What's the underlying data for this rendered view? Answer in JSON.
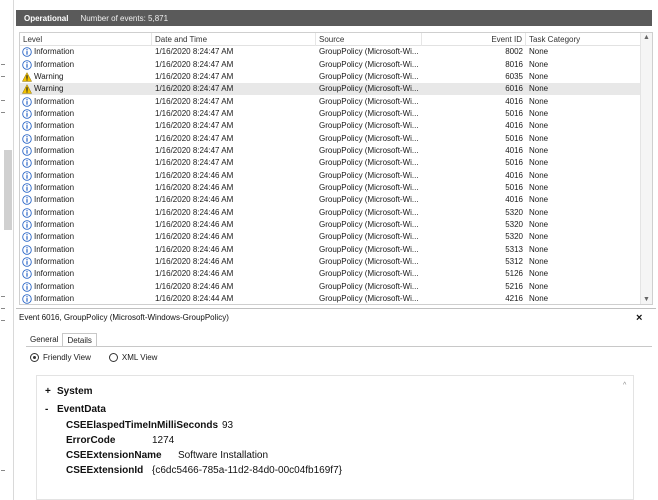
{
  "header": {
    "title": "Operational",
    "event_count": "Number of events: 5,871"
  },
  "columns": {
    "level": "Level",
    "date": "Date and Time",
    "source": "Source",
    "event_id": "Event ID",
    "task_category": "Task Category"
  },
  "icons": {
    "information": "info-icon",
    "warning": "warning-icon"
  },
  "colors": {
    "info": "#2a66c7",
    "warning": "#f2c200",
    "header_bg": "#5a5a5a",
    "selected_row": "#e8e8e8"
  },
  "events": [
    {
      "level": "Information",
      "date": "1/16/2020 8:24:47 AM",
      "source": "GroupPolicy (Microsoft-Wi...",
      "id": "8002",
      "category": "None"
    },
    {
      "level": "Information",
      "date": "1/16/2020 8:24:47 AM",
      "source": "GroupPolicy (Microsoft-Wi...",
      "id": "8016",
      "category": "None"
    },
    {
      "level": "Warning",
      "date": "1/16/2020 8:24:47 AM",
      "source": "GroupPolicy (Microsoft-Wi...",
      "id": "6035",
      "category": "None"
    },
    {
      "level": "Warning",
      "date": "1/16/2020 8:24:47 AM",
      "source": "GroupPolicy (Microsoft-Wi...",
      "id": "6016",
      "category": "None",
      "selected": true
    },
    {
      "level": "Information",
      "date": "1/16/2020 8:24:47 AM",
      "source": "GroupPolicy (Microsoft-Wi...",
      "id": "4016",
      "category": "None"
    },
    {
      "level": "Information",
      "date": "1/16/2020 8:24:47 AM",
      "source": "GroupPolicy (Microsoft-Wi...",
      "id": "5016",
      "category": "None"
    },
    {
      "level": "Information",
      "date": "1/16/2020 8:24:47 AM",
      "source": "GroupPolicy (Microsoft-Wi...",
      "id": "4016",
      "category": "None"
    },
    {
      "level": "Information",
      "date": "1/16/2020 8:24:47 AM",
      "source": "GroupPolicy (Microsoft-Wi...",
      "id": "5016",
      "category": "None"
    },
    {
      "level": "Information",
      "date": "1/16/2020 8:24:47 AM",
      "source": "GroupPolicy (Microsoft-Wi...",
      "id": "4016",
      "category": "None"
    },
    {
      "level": "Information",
      "date": "1/16/2020 8:24:47 AM",
      "source": "GroupPolicy (Microsoft-Wi...",
      "id": "5016",
      "category": "None"
    },
    {
      "level": "Information",
      "date": "1/16/2020 8:24:46 AM",
      "source": "GroupPolicy (Microsoft-Wi...",
      "id": "4016",
      "category": "None"
    },
    {
      "level": "Information",
      "date": "1/16/2020 8:24:46 AM",
      "source": "GroupPolicy (Microsoft-Wi...",
      "id": "5016",
      "category": "None"
    },
    {
      "level": "Information",
      "date": "1/16/2020 8:24:46 AM",
      "source": "GroupPolicy (Microsoft-Wi...",
      "id": "4016",
      "category": "None"
    },
    {
      "level": "Information",
      "date": "1/16/2020 8:24:46 AM",
      "source": "GroupPolicy (Microsoft-Wi...",
      "id": "5320",
      "category": "None"
    },
    {
      "level": "Information",
      "date": "1/16/2020 8:24:46 AM",
      "source": "GroupPolicy (Microsoft-Wi...",
      "id": "5320",
      "category": "None"
    },
    {
      "level": "Information",
      "date": "1/16/2020 8:24:46 AM",
      "source": "GroupPolicy (Microsoft-Wi...",
      "id": "5320",
      "category": "None"
    },
    {
      "level": "Information",
      "date": "1/16/2020 8:24:46 AM",
      "source": "GroupPolicy (Microsoft-Wi...",
      "id": "5313",
      "category": "None"
    },
    {
      "level": "Information",
      "date": "1/16/2020 8:24:46 AM",
      "source": "GroupPolicy (Microsoft-Wi...",
      "id": "5312",
      "category": "None"
    },
    {
      "level": "Information",
      "date": "1/16/2020 8:24:46 AM",
      "source": "GroupPolicy (Microsoft-Wi...",
      "id": "5126",
      "category": "None"
    },
    {
      "level": "Information",
      "date": "1/16/2020 8:24:46 AM",
      "source": "GroupPolicy (Microsoft-Wi...",
      "id": "5216",
      "category": "None"
    },
    {
      "level": "Information",
      "date": "1/16/2020 8:24:44 AM",
      "source": "GroupPolicy (Microsoft-Wi...",
      "id": "4216",
      "category": "None"
    }
  ],
  "detail": {
    "title": "Event 6016, GroupPolicy (Microsoft-Windows-GroupPolicy)",
    "close": "×",
    "tabs": [
      "General",
      "Details"
    ],
    "views": [
      "Friendly View",
      "XML View"
    ],
    "system_toggle": "+",
    "system_label": "System",
    "eventdata_toggle": "-",
    "eventdata_label": "EventData",
    "fields": [
      {
        "key": "CSEElaspedTimeInMilliSeconds",
        "value": "93"
      },
      {
        "key": "ErrorCode",
        "value": "1274"
      },
      {
        "key": "CSEExtensionName",
        "value": "Software Installation"
      },
      {
        "key": "CSEExtensionId",
        "value": "{c6dc5466-785a-11d2-84d0-00c04fb169f7}"
      }
    ]
  }
}
